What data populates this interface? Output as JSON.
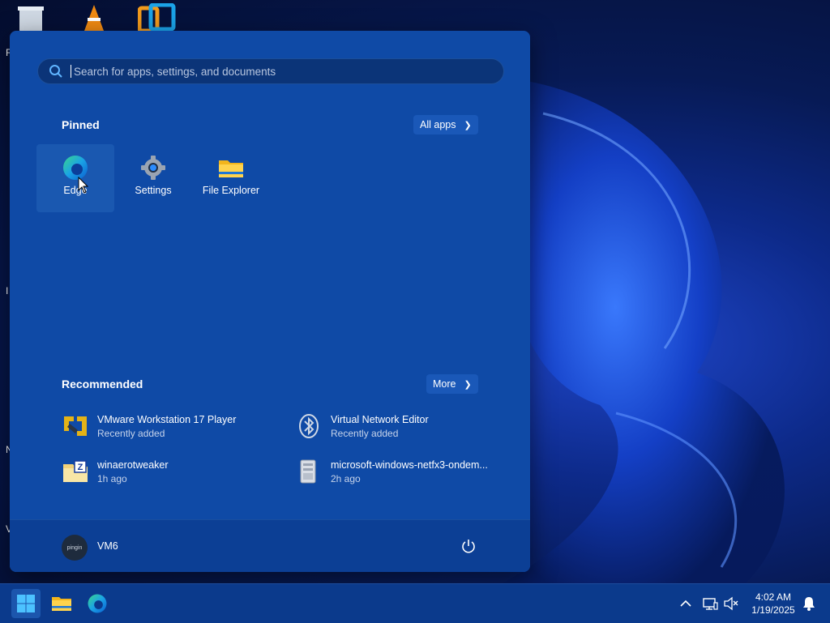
{
  "search": {
    "placeholder": "Search for apps, settings, and documents"
  },
  "pinned": {
    "title": "Pinned",
    "all_apps_label": "All apps",
    "apps": [
      {
        "label": "Edge",
        "icon": "edge-icon"
      },
      {
        "label": "Settings",
        "icon": "settings-icon"
      },
      {
        "label": "File Explorer",
        "icon": "file-explorer-icon"
      }
    ]
  },
  "recommended": {
    "title": "Recommended",
    "more_label": "More",
    "items": [
      {
        "name": "VMware Workstation 17 Player",
        "detail": "Recently added",
        "icon": "vmware-icon"
      },
      {
        "name": "Virtual Network Editor",
        "detail": "Recently added",
        "icon": "bluetooth-network-icon"
      },
      {
        "name": "winaerotweaker",
        "detail": "1h ago",
        "icon": "zip-folder-icon"
      },
      {
        "name": "microsoft-windows-netfx3-ondem...",
        "detail": "2h ago",
        "icon": "package-icon"
      }
    ]
  },
  "user": {
    "name": "VM6",
    "avatar_text": "pingin"
  },
  "taskbar": {
    "time": "4:02 AM",
    "date": "1/19/2025"
  },
  "colors": {
    "menu_bg": "#0f4aa6",
    "taskbar_bg": "#0b3a8c",
    "accent": "#1a58b8"
  }
}
